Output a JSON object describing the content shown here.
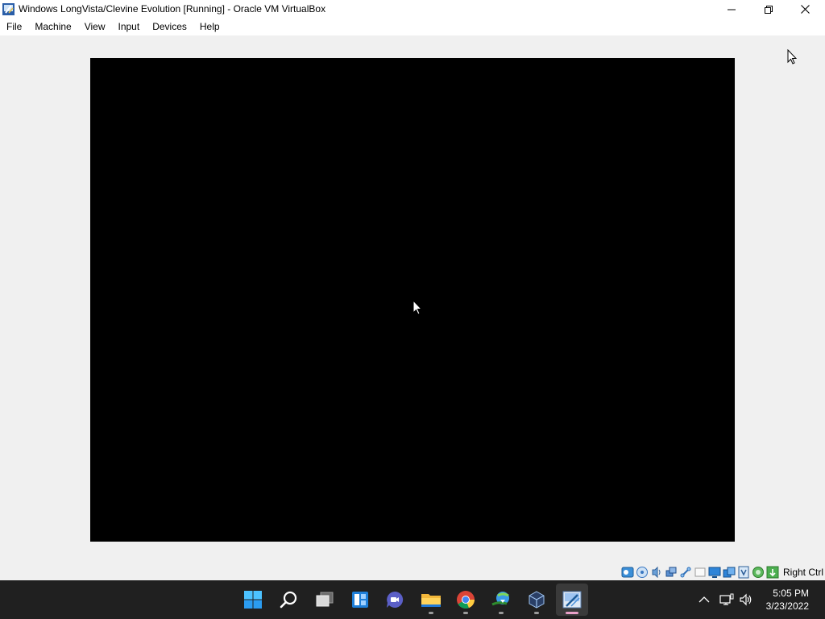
{
  "window": {
    "title": "Windows LongVista/Clevine Evolution [Running] - Oracle VM VirtualBox"
  },
  "menu": {
    "items": [
      {
        "label": "File"
      },
      {
        "label": "Machine"
      },
      {
        "label": "View"
      },
      {
        "label": "Input"
      },
      {
        "label": "Devices"
      },
      {
        "label": "Help"
      }
    ]
  },
  "statusbar": {
    "host_key": "Right Ctrl",
    "icons": [
      "hard-disk-icon",
      "optical-drive-icon",
      "audio-icon",
      "network-icon",
      "usb-icon",
      "shared-folders-icon",
      "display-icon",
      "video-capture-icon",
      "mouse-integration-icon",
      "recording-icon",
      "cpu-icon",
      "keyboard-icon"
    ]
  },
  "taskbar": {
    "apps": [
      "start-icon",
      "search-icon",
      "task-view-icon",
      "widgets-icon",
      "chat-icon",
      "file-explorer-icon",
      "chrome-icon",
      "internet-download-manager-icon",
      "virtualbox-icon",
      "virtualbox-vm-icon"
    ]
  },
  "clock": {
    "time": "5:05 PM",
    "date": "3/23/2022"
  },
  "colors": {
    "taskbar": "#202020",
    "guest_screen": "#000000",
    "window_bg": "#f0f0f0"
  }
}
